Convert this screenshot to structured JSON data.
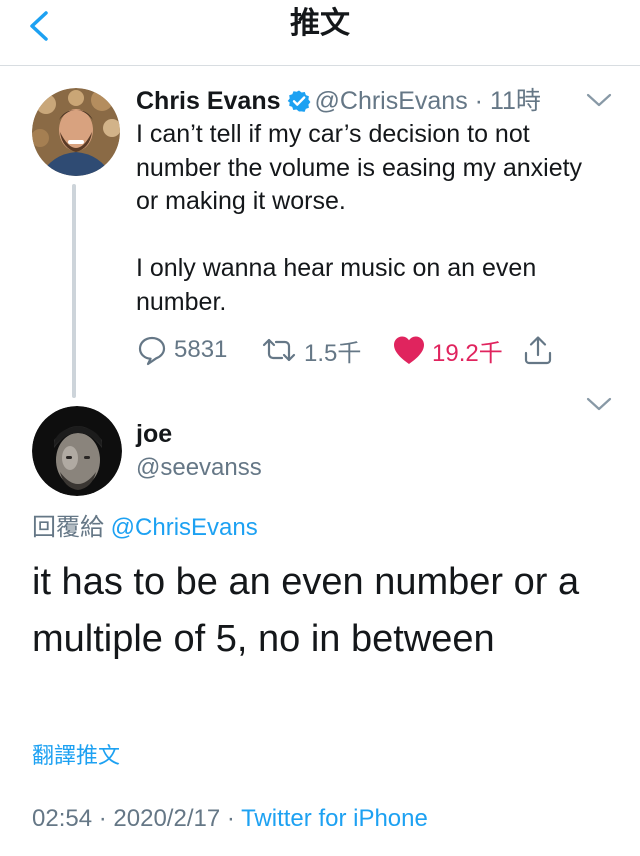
{
  "header": {
    "title": "推文"
  },
  "tweet": {
    "name": "Chris Evans",
    "handle": "@ChrisEvans",
    "separator": "·",
    "time": "11時",
    "text_1": "I can’t tell if my car’s decision to not number the volume is easing my anxiety or making it worse.",
    "text_2": "I only wanna hear music on an even number.",
    "replies": "5831",
    "retweets": "1.5千",
    "likes": "19.2千"
  },
  "reply": {
    "name": "joe",
    "handle": "@seevanss",
    "replying_to_label": "回覆給",
    "replying_to_handle": "@ChrisEvans",
    "text": "it has to be an even number or a multiple of 5, no in between",
    "translate": "翻譯推文",
    "time": "02:54",
    "separator": "·",
    "date": "2020/2/17",
    "source": "Twitter for iPhone"
  },
  "colors": {
    "accent": "#1da1f2",
    "muted": "#657786",
    "like": "#e0245e"
  }
}
